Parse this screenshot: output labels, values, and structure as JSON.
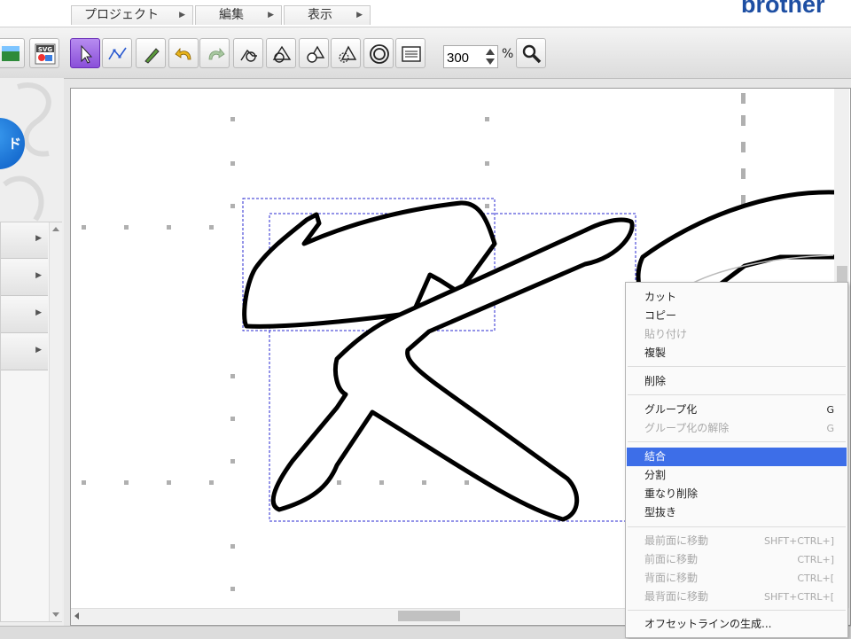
{
  "menubar": {
    "tabs": [
      {
        "label": "プロジェクト"
      },
      {
        "label": "編集"
      },
      {
        "label": "表示"
      }
    ],
    "brand": "brother"
  },
  "toolbar": {
    "buttons": [
      {
        "icon": "image-import-icon"
      },
      {
        "icon": "svg-import-icon",
        "label": "SVG"
      },
      {
        "icon": "select-arrow-icon",
        "active": true
      },
      {
        "icon": "point-edit-icon"
      },
      {
        "icon": "pen-draw-icon"
      },
      {
        "icon": "undo-icon"
      },
      {
        "icon": "redo-icon"
      },
      {
        "icon": "shape-add-icon"
      },
      {
        "icon": "shape-weld-icon"
      },
      {
        "icon": "shape-subtract-icon"
      },
      {
        "icon": "shape-intersect-icon"
      },
      {
        "icon": "offset-ring-icon"
      },
      {
        "icon": "list-panel-icon"
      }
    ],
    "zoom_value": "300",
    "zoom_unit": "%"
  },
  "left_panel": {
    "accent_label": "ド"
  },
  "context_menu": {
    "items": [
      {
        "label": "カット",
        "shortcut": "",
        "enabled": true
      },
      {
        "label": "コピー",
        "shortcut": "",
        "enabled": true
      },
      {
        "label": "貼り付け",
        "shortcut": "",
        "enabled": false
      },
      {
        "label": "複製",
        "shortcut": "",
        "enabled": true
      },
      {
        "label": "削除",
        "shortcut": "",
        "enabled": true
      },
      {
        "label": "グループ化",
        "shortcut": "G",
        "enabled": true
      },
      {
        "label": "グループ化の解除",
        "shortcut": "G",
        "enabled": false
      },
      {
        "label": "結合",
        "shortcut": "",
        "enabled": true,
        "selected": true
      },
      {
        "label": "分割",
        "shortcut": "",
        "enabled": true
      },
      {
        "label": "重なり削除",
        "shortcut": "",
        "enabled": true
      },
      {
        "label": "型抜き",
        "shortcut": "",
        "enabled": true
      },
      {
        "label": "最前面に移動",
        "shortcut": "SHFT+CTRL+]",
        "enabled": false
      },
      {
        "label": "前面に移動",
        "shortcut": "CTRL+]",
        "enabled": false
      },
      {
        "label": "背面に移動",
        "shortcut": "CTRL+[",
        "enabled": false
      },
      {
        "label": "最背面に移動",
        "shortcut": "SHFT+CTRL+[",
        "enabled": false
      },
      {
        "label": "オフセットラインの生成...",
        "shortcut": "",
        "enabled": true
      }
    ]
  },
  "colors": {
    "accent_selected": "#3d6ee8",
    "active_tool": "#8a4fd9",
    "selection_box": "#2a2ad0",
    "brand": "#1e4fa3"
  }
}
